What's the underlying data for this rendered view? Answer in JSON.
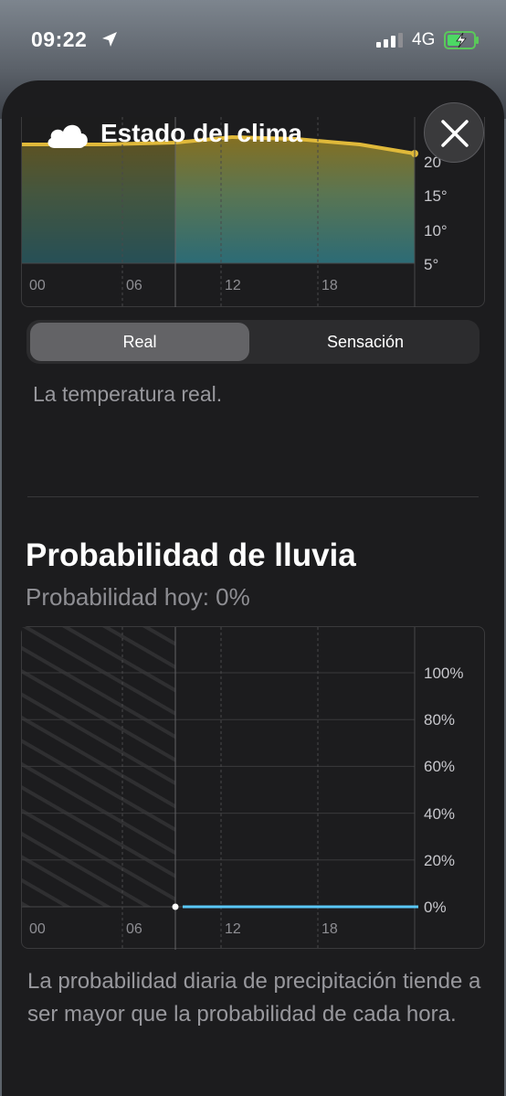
{
  "status_bar": {
    "time": "09:22",
    "network": "4G",
    "location_icon": "location-arrow-icon",
    "signal_icon": "signal-bars-icon",
    "battery_icon": "battery-charging-icon"
  },
  "header": {
    "title": "Estado del clima",
    "icon": "cloud-icon",
    "close_icon": "close-icon"
  },
  "temperature_chart": {
    "x_ticks": [
      "00",
      "06",
      "12",
      "18"
    ],
    "y_ticks": [
      "5°",
      "10°",
      "15°",
      "20°"
    ],
    "colors": {
      "line": "#e0b93a",
      "fill_top": "#7a6a25",
      "fill_bottom": "#2e6a73"
    }
  },
  "segmented_control": {
    "options": [
      "Real",
      "Sensación"
    ],
    "selected": "Real"
  },
  "temperature_description": "La temperatura real.",
  "rain": {
    "title": "Probabilidad de lluvia",
    "subtitle": "Probabilidad hoy: 0%",
    "description": "La probabilidad diaria de precipitación tiende a ser mayor que la probabilidad de cada hora."
  },
  "chart_data": {
    "type": "line",
    "title": "",
    "xlabel": "",
    "ylabel": "",
    "x_ticks": [
      "00",
      "06",
      "12",
      "18"
    ],
    "y_ticks": [
      "0%",
      "20%",
      "40%",
      "60%",
      "80%",
      "100%"
    ],
    "ylim": [
      0,
      100
    ],
    "series": [
      {
        "values": [
          0,
          0,
          0,
          0,
          0,
          0,
          0,
          0,
          0,
          0,
          0,
          0,
          0,
          0,
          0
        ],
        "x": [
          10,
          11,
          12,
          13,
          14,
          15,
          16,
          17,
          18,
          19,
          20,
          21,
          22,
          23,
          24
        ]
      }
    ],
    "colors": {
      "line": "#5ac8fa",
      "past_hatch": "#2a2a2c"
    },
    "grid": true
  }
}
